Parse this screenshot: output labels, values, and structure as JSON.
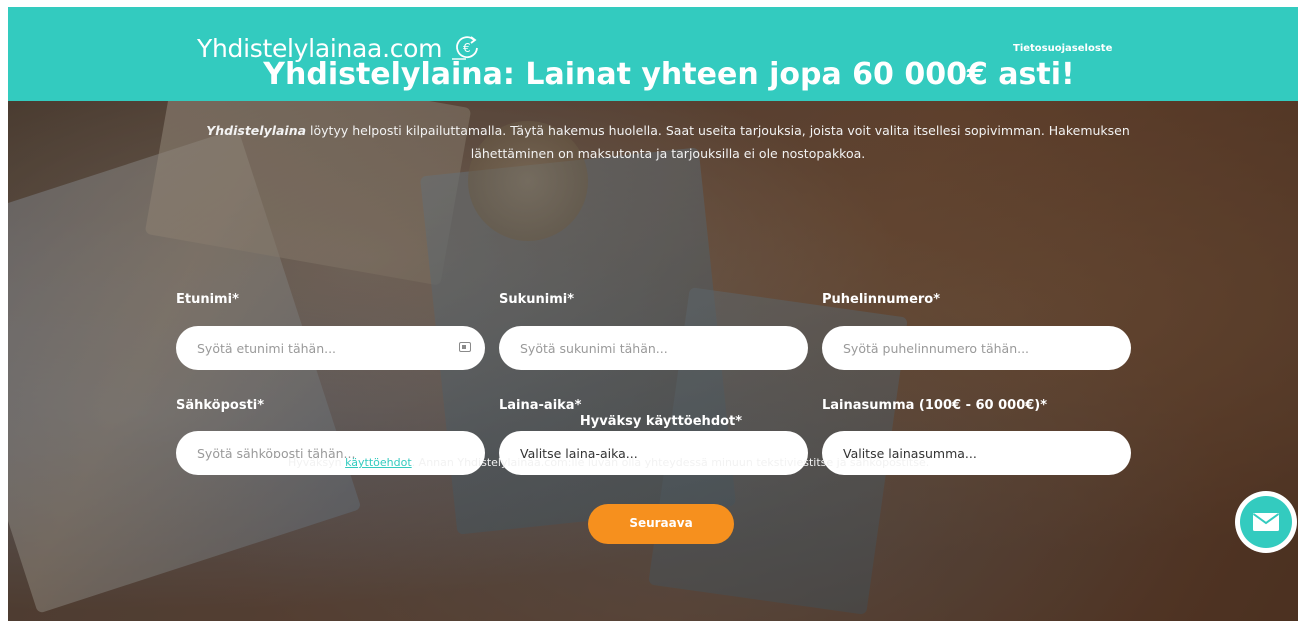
{
  "header": {
    "logo_text": "Yhdistelylainaa.com",
    "nav_link": "Tietosuojaseloste",
    "brand_color": "#33cbbf"
  },
  "hero": {
    "title": "Yhdistelylaina: Lainat yhteen jopa 60 000€ asti!",
    "desc_bold": "Yhdistelylaina",
    "desc_rest": " löytyy helposti kilpailuttamalla. Täytä hakemus huolella. Saat useita tarjouksia, joista voit valita itsellesi sopivimman. Hakemuksen lähettäminen on maksutonta ja tarjouksilla ei ole nostopakkoa."
  },
  "form": {
    "first_name": {
      "label": "Etunimi*",
      "placeholder": "Syötä etunimi tähän..."
    },
    "last_name": {
      "label": "Sukunimi*",
      "placeholder": "Syötä sukunimi tähän..."
    },
    "phone": {
      "label": "Puhelinnumero*",
      "placeholder": "Syötä puhelinnumero tähän..."
    },
    "email": {
      "label": "Sähköposti*",
      "placeholder": "Syötä sähköposti tähän..."
    },
    "loan_term": {
      "label": "Laina-aika*",
      "value": "Valitse laina-aika..."
    },
    "loan_amount": {
      "label": "Lainasumma (100€ - 60 000€)*",
      "value": "Valitse lainasumma..."
    },
    "terms_heading": "Hyväksy käyttöehdot*",
    "consent_prefix": "Hyväksyn ",
    "consent_link": "käyttöehdot",
    "consent_suffix": ". Annan Yhdistelylainaa.com:lle luvan olla yhteydessä minuun tekstiviestitse ja sähköpostitse.",
    "submit_label": "Seuraava",
    "submit_color": "#f6901e"
  },
  "widgets": {
    "chat_icon": "envelope-icon"
  }
}
